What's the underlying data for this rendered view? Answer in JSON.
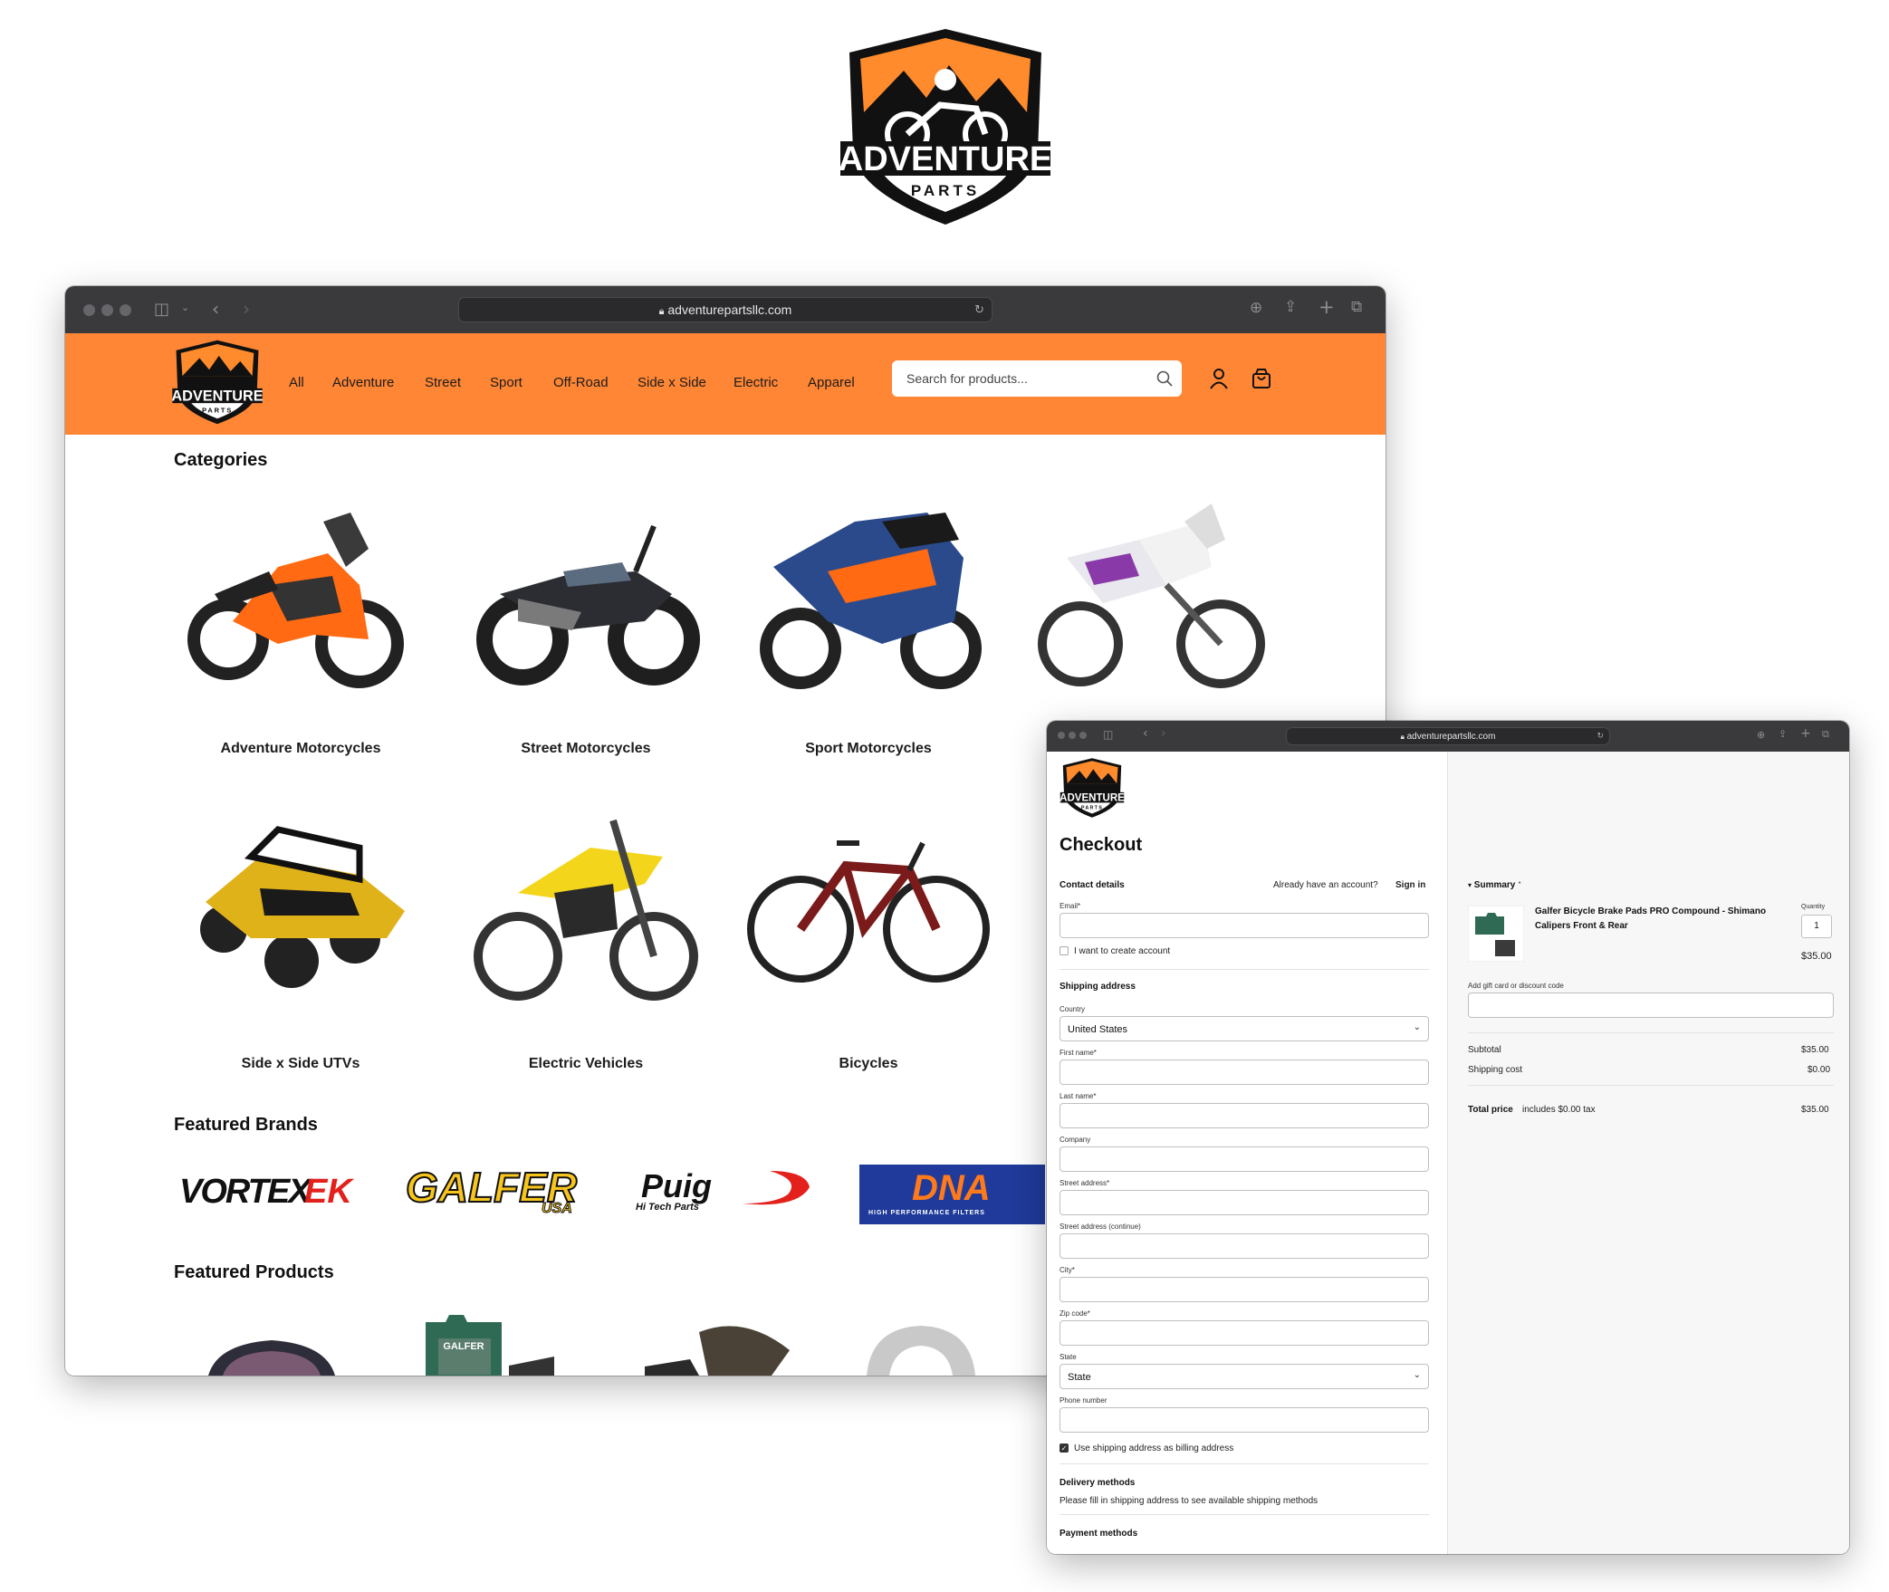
{
  "hero": {
    "logo_word1": "ADVENTURE",
    "logo_word2": "PARTS"
  },
  "main_window": {
    "url": "adventurepartsllc.com",
    "nav": [
      "All",
      "Adventure",
      "Street",
      "Sport",
      "Off-Road",
      "Side x Side",
      "Electric",
      "Apparel"
    ],
    "search_placeholder": "Search for products...",
    "logo_word1": "ADVENTURE",
    "logo_word2": "PARTS",
    "categories_title": "Categories",
    "categories": [
      {
        "label": "Adventure Motorcycles"
      },
      {
        "label": "Street Motorcycles"
      },
      {
        "label": "Sport Motorcycles"
      },
      {
        "label": ""
      },
      {
        "label": "Side x Side UTVs"
      },
      {
        "label": "Electric Vehicles"
      },
      {
        "label": "Bicycles"
      }
    ],
    "brands_title": "Featured Brands",
    "brands": [
      {
        "name": "VORTEX",
        "suffix": "EK"
      },
      {
        "name": "GALFER",
        "suffix": "USA"
      },
      {
        "name": "Puig",
        "suffix": "Hi Tech Parts"
      },
      {
        "name": "DNA",
        "suffix": "HIGH PERFORMANCE FILTERS"
      }
    ],
    "products_title": "Featured Products",
    "product_pad_text": "GALFER"
  },
  "checkout_window": {
    "url": "adventurepartsllc.com",
    "logo_word1": "ADVENTURE",
    "logo_word2": "PARTS",
    "title": "Checkout",
    "contact_heading": "Contact details",
    "have_account": "Already have an account?",
    "sign_in": "Sign in",
    "email_label": "Email*",
    "create_account": "I want to create account",
    "shipping_heading": "Shipping address",
    "country_label": "Country",
    "country_value": "United States",
    "first_name_label": "First name*",
    "last_name_label": "Last name*",
    "company_label": "Company",
    "street_label": "Street address*",
    "street2_label": "Street address (continue)",
    "city_label": "City*",
    "zip_label": "Zip code*",
    "state_label": "State",
    "state_value": "State",
    "phone_label": "Phone number",
    "billing_same": "Use shipping address as billing address",
    "delivery_heading": "Delivery methods",
    "delivery_note": "Please fill in shipping address to see available shipping methods",
    "payment_heading": "Payment methods",
    "summary": {
      "title": "Summary",
      "item_name_1": "Galfer Bicycle Brake Pads PRO Compound - Shimano",
      "item_name_2": "Calipers Front & Rear",
      "quantity_label": "Quantity",
      "quantity": "1",
      "item_price": "$35.00",
      "discount_label": "Add gift card or discount code",
      "subtotal_label": "Subtotal",
      "subtotal": "$35.00",
      "shipping_label": "Shipping cost",
      "shipping": "$0.00",
      "total_label": "Total price",
      "total_note": "includes $0.00 tax",
      "total": "$35.00"
    }
  }
}
